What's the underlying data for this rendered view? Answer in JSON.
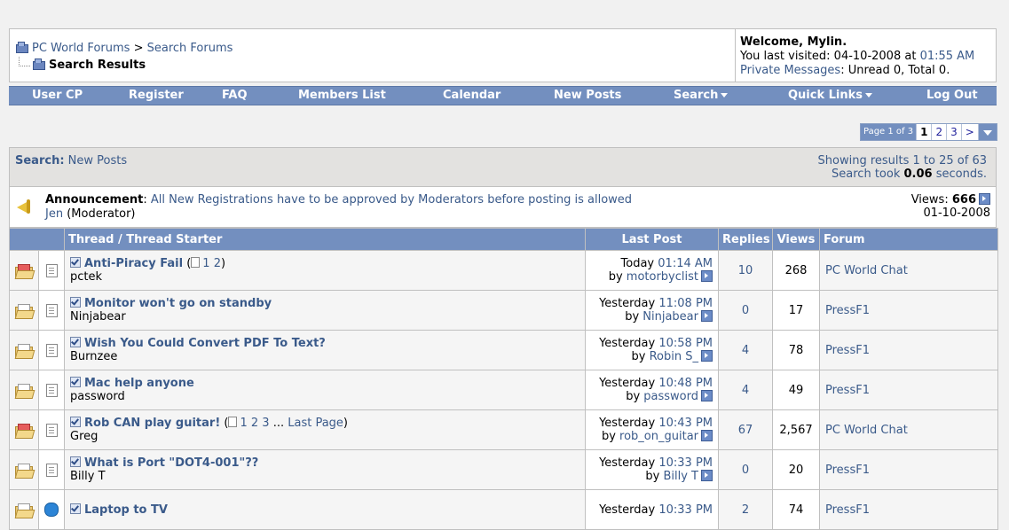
{
  "breadcrumb": {
    "site": "PC World Forums",
    "separator": ">",
    "section": "Search Forums",
    "current": "Search Results"
  },
  "welcome": {
    "greeting": "Welcome, Mylin.",
    "last_visited_prefix": "You last visited: 04-10-2008 at",
    "last_visited_time": "01:55 AM",
    "pm_label": "Private Messages",
    "pm_status": ": Unread 0, Total 0."
  },
  "navbar": {
    "items": [
      "User CP",
      "Register",
      "FAQ",
      "Members List",
      "Calendar",
      "New Posts",
      "Search",
      "Quick Links",
      "Log Out"
    ]
  },
  "pagination": {
    "info": "Page 1 of 3",
    "pages": [
      "1",
      "2",
      "3"
    ],
    "next": ">"
  },
  "search": {
    "label": "Search:",
    "query": "New Posts",
    "showing": "Showing results 1 to 25 of 63",
    "took_prefix": "Search took",
    "took_value": "0.06",
    "took_suffix": "seconds."
  },
  "announcement": {
    "label": "Announcement",
    "colon": ":",
    "text": "All New Registrations have to be approved by Moderators before posting is allowed",
    "author": "Jen",
    "author_role": "(Moderator)",
    "views_label": "Views:",
    "views": "666",
    "date": "01-10-2008"
  },
  "table": {
    "headers": {
      "thread": "Thread / Thread Starter",
      "last_post": "Last Post",
      "replies": "Replies",
      "views": "Views",
      "forum": "Forum"
    },
    "rows": [
      {
        "title": "Anti-Piracy Fail",
        "pages": [
          "1",
          "2"
        ],
        "last_page": "",
        "starter": "pctek",
        "day": "Today",
        "time": "01:14 AM",
        "by": "by",
        "poster": "motorbyclist",
        "replies": "10",
        "views": "268",
        "forum": "PC World Chat",
        "hot": true
      },
      {
        "title": "Monitor won't go on standby",
        "pages": [],
        "last_page": "",
        "starter": "Ninjabear",
        "day": "Yesterday",
        "time": "11:08 PM",
        "by": "by",
        "poster": "Ninjabear",
        "replies": "0",
        "views": "17",
        "forum": "PressF1",
        "hot": false
      },
      {
        "title": "Wish You Could Convert PDF To Text?",
        "pages": [],
        "last_page": "",
        "starter": "Burnzee",
        "day": "Yesterday",
        "time": "10:58 PM",
        "by": "by",
        "poster": "Robin S_",
        "replies": "4",
        "views": "78",
        "forum": "PressF1",
        "hot": false
      },
      {
        "title": "Mac help anyone",
        "pages": [],
        "last_page": "",
        "starter": "password",
        "day": "Yesterday",
        "time": "10:48 PM",
        "by": "by",
        "poster": "password",
        "replies": "4",
        "views": "49",
        "forum": "PressF1",
        "hot": false
      },
      {
        "title": "Rob CAN play guitar!",
        "pages": [
          "1",
          "2",
          "3"
        ],
        "last_page": "Last Page",
        "starter": "Greg",
        "day": "Yesterday",
        "time": "10:43 PM",
        "by": "by",
        "poster": "rob_on_guitar",
        "replies": "67",
        "views": "2,567",
        "forum": "PC World Chat",
        "hot": true
      },
      {
        "title": "What is Port \"DOT4-001\"??",
        "pages": [],
        "last_page": "",
        "starter": "Billy T",
        "day": "Yesterday",
        "time": "10:33 PM",
        "by": "by",
        "poster": "Billy T",
        "replies": "0",
        "views": "20",
        "forum": "PressF1",
        "hot": false
      },
      {
        "title": "Laptop to TV",
        "pages": [],
        "last_page": "",
        "starter": "",
        "day": "Yesterday",
        "time": "10:33 PM",
        "by": "",
        "poster": "",
        "replies": "2",
        "views": "74",
        "forum": "PressF1",
        "hot": false
      }
    ]
  }
}
